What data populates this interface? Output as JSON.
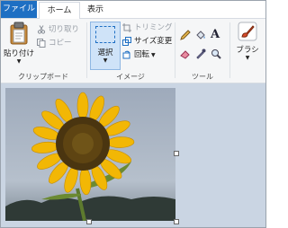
{
  "tabs": {
    "file": "ファイル",
    "home": "ホーム",
    "view": "表示"
  },
  "clipboard": {
    "paste": "貼り付け",
    "cut": "切り取り",
    "copy": "コピー",
    "label": "クリップボード"
  },
  "image": {
    "select": "選択",
    "crop": "トリミング",
    "resize": "サイズ変更",
    "rotate": "回転",
    "label": "イメージ"
  },
  "tools": {
    "label": "ツール"
  },
  "brush": {
    "label": "ブラシ"
  },
  "colors": {
    "accent": "#1e6fc3",
    "ribbon": "#f5f6f7",
    "canvas": "#cad5e3"
  }
}
